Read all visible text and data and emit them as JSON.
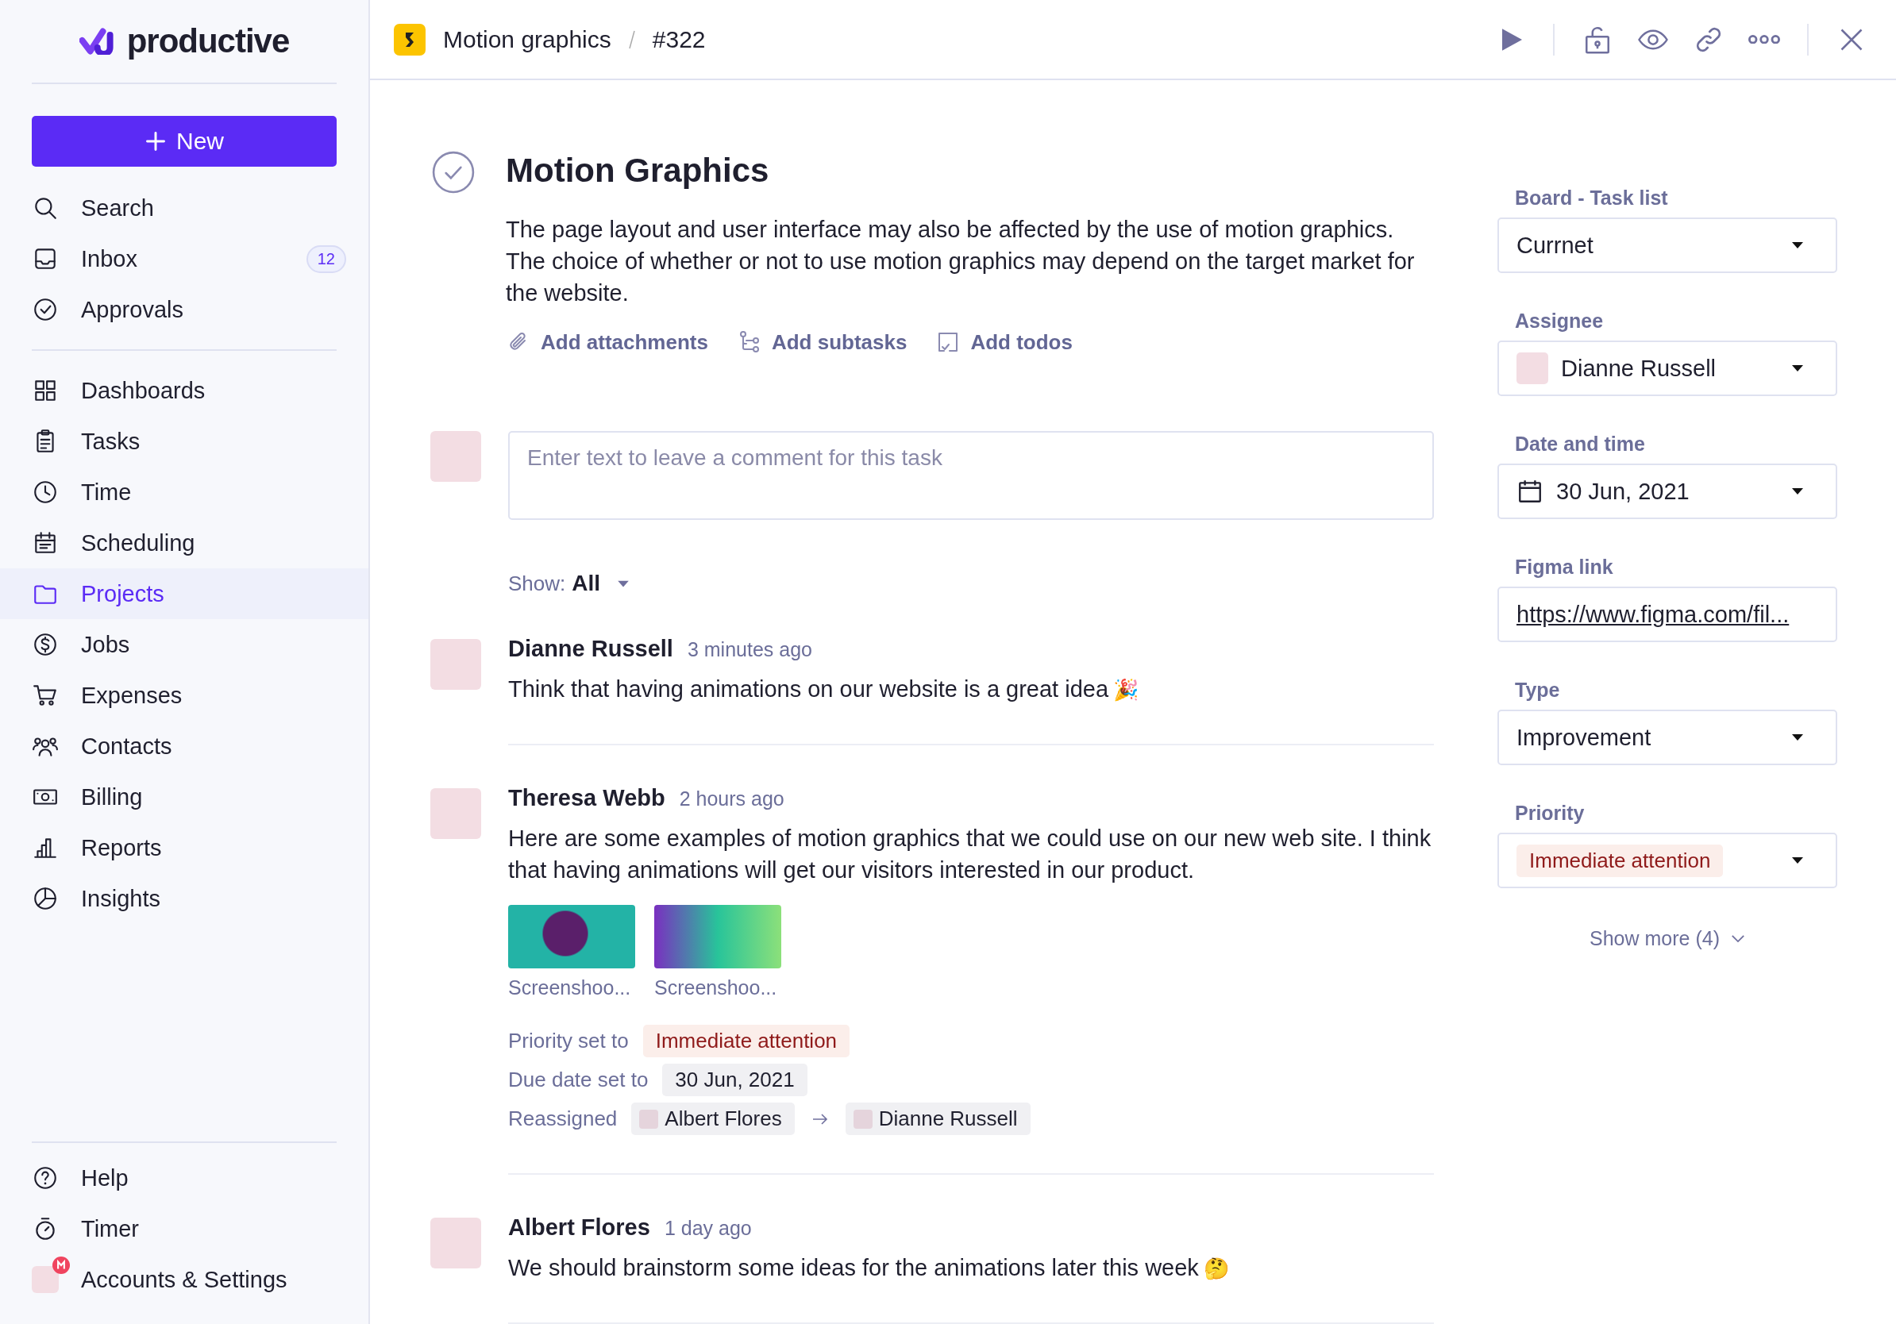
{
  "sidebar": {
    "logo": "productive",
    "new_button": "New",
    "groups": [
      [
        {
          "label": "Search",
          "selected": false
        },
        {
          "label": "Inbox",
          "selected": false,
          "badge": "12"
        },
        {
          "label": "Approvals",
          "selected": false
        }
      ],
      [
        {
          "label": "Dashboards",
          "selected": false
        },
        {
          "label": "Tasks",
          "selected": false
        },
        {
          "label": "Time",
          "selected": false
        },
        {
          "label": "Scheduling",
          "selected": false
        },
        {
          "label": "Projects",
          "selected": true
        },
        {
          "label": "Jobs",
          "selected": false
        },
        {
          "label": "Expenses",
          "selected": false
        },
        {
          "label": "Contacts",
          "selected": false
        },
        {
          "label": "Billing",
          "selected": false
        },
        {
          "label": "Reports",
          "selected": false
        },
        {
          "label": "Insights",
          "selected": false
        }
      ]
    ],
    "footer": [
      {
        "label": "Help"
      },
      {
        "label": "Timer"
      },
      {
        "label": "Accounts & Settings"
      }
    ]
  },
  "header": {
    "breadcrumb": [
      "Motion graphics",
      "#322"
    ]
  },
  "task": {
    "title": "Motion Graphics",
    "description": "The page layout and user interface may also be affected by the use of motion graphics. The choice of whether or not to use motion graphics may depend on the target market for the website.",
    "actions": [
      "Add attachments",
      "Add subtasks",
      "Add todos"
    ],
    "comment_box": {
      "placeholder": "Enter text to leave a comment for this task"
    },
    "filter": {
      "label": "Show:",
      "value": "All"
    },
    "activity": [
      {
        "author": "Dianne Russell",
        "time": "3 minutes ago",
        "text": "Think that having animations on our website is a great idea",
        "emoji": "🎉"
      },
      {
        "author": "Theresa Webb",
        "time": "2 hours ago",
        "text": "Here are some examples of motion graphics that we could use on our new web site. I think that having animations will get our visitors interested in our product.",
        "attachments": [
          {
            "name": "Screenshoo..."
          },
          {
            "name": "Screenshoo..."
          }
        ],
        "changes": [
          {
            "kind": "priority",
            "label": "Priority set to",
            "value": "Immediate attention"
          },
          {
            "kind": "date",
            "label": "Due date set to",
            "value": "30 Jun, 2021"
          },
          {
            "kind": "reassign",
            "label": "Reassigned",
            "from": "Albert Flores",
            "to": "Dianne Russell"
          }
        ]
      },
      {
        "author": "Albert Flores",
        "time": "1 day ago",
        "text": "We should brainstorm some ideas for the animations later this week",
        "emoji": "🤔"
      }
    ]
  },
  "details": {
    "fields": [
      {
        "kind": "select",
        "label": "Board - Task list",
        "value": "Currnet"
      },
      {
        "kind": "person",
        "label": "Assignee",
        "value": "Dianne Russell"
      },
      {
        "kind": "date",
        "label": "Date and time",
        "value": "30 Jun, 2021"
      },
      {
        "kind": "link",
        "label": "Figma link",
        "value": "https://www.figma.com/fil..."
      },
      {
        "kind": "select",
        "label": "Type",
        "value": "Improvement"
      },
      {
        "kind": "tag",
        "label": "Priority",
        "value": "Immediate attention"
      }
    ],
    "show_more": "Show more (4)"
  }
}
